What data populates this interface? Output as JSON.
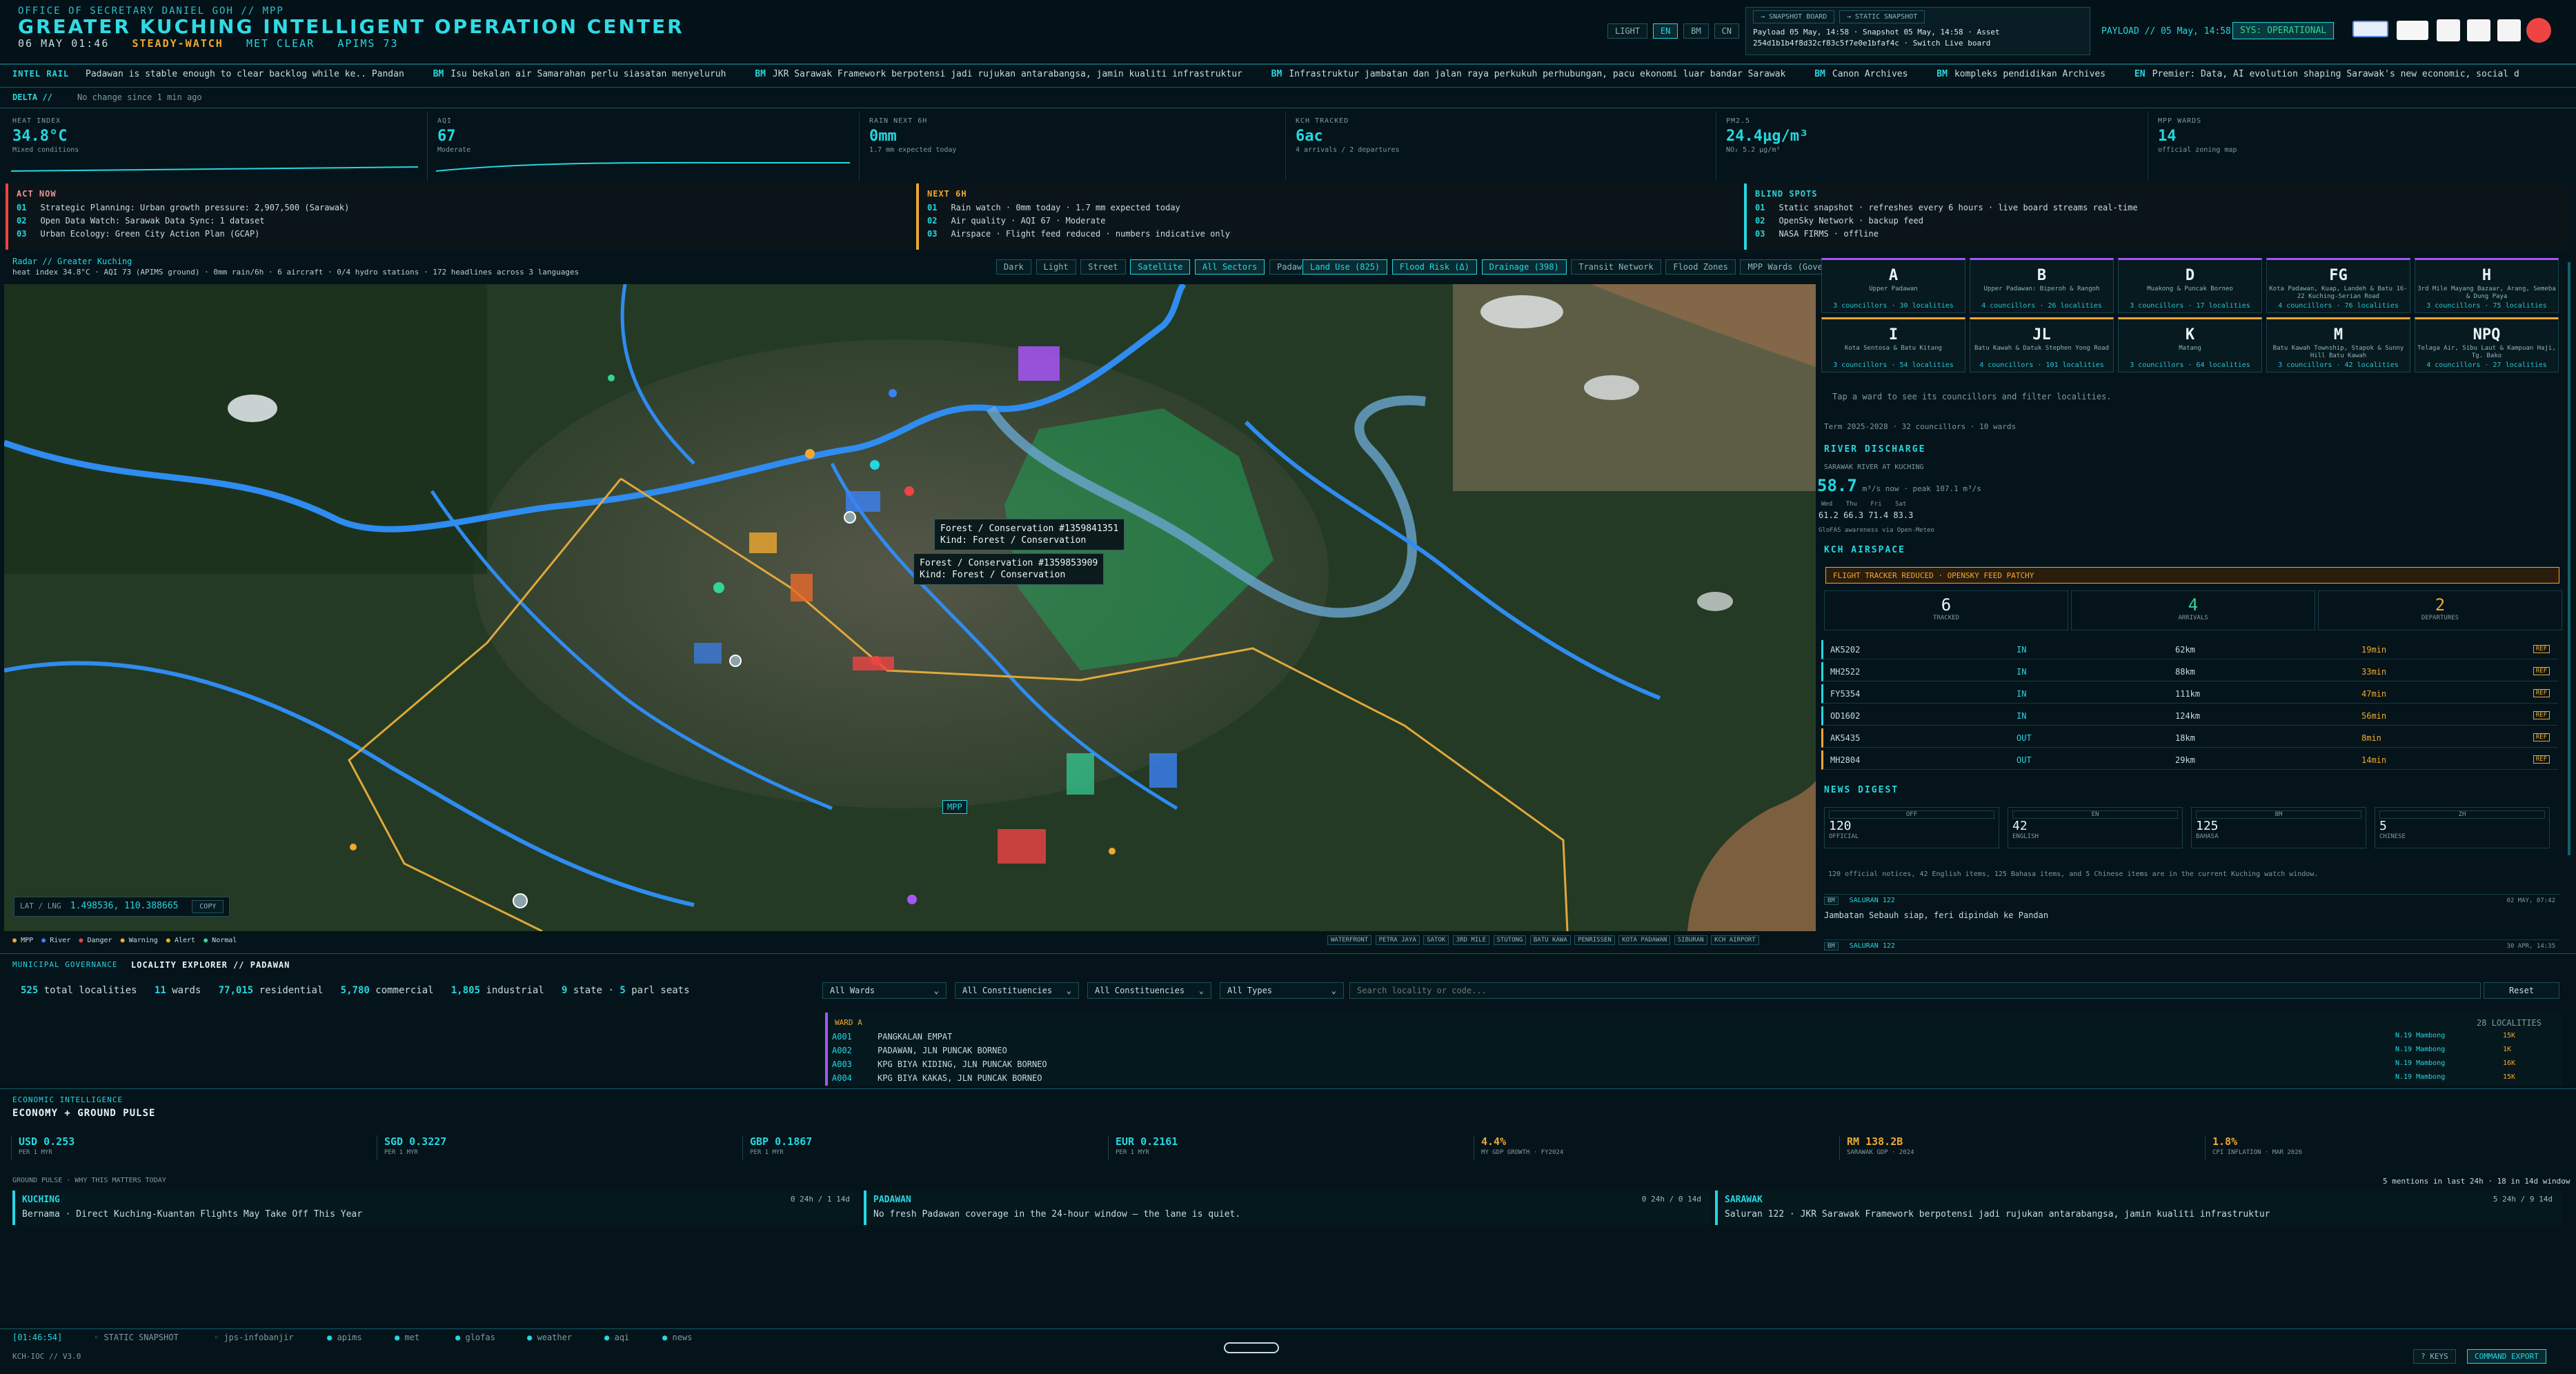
{
  "header": {
    "office": "OFFICE OF SECRETARY DANIEL GOH // MPP",
    "title": "GREATER KUCHING INTELLIGENT OPERATION CENTER",
    "date": "06 MAY 01:46",
    "mode": "STEADY-WATCH",
    "met": "MET CLEAR",
    "apims": "APIMS 73",
    "lang_buttons": [
      "LIGHT",
      "EN",
      "BM",
      "CN"
    ],
    "snapshot_buttons": [
      "→ SNAPSHOT BOARD",
      "→ STATIC SNAPSHOT"
    ],
    "payload_line": "Payload 05 May, 14:58 · Snapshot 05 May, 14:58 · Asset",
    "hash_line": "254d1b1b4f8d32cf83c5f7e0e1bfaf4c · Switch Live board",
    "payload_right": "PAYLOAD // 05 May, 14:58",
    "sys_status": "SYS: OPERATIONAL"
  },
  "rail": {
    "label": "INTEL RAIL",
    "items": [
      {
        "tag": "",
        "text": "Padawan is stable enough to clear backlog while ke.. Pandan"
      },
      {
        "tag": "BM",
        "text": "Isu bekalan air Samarahan perlu siasatan menyeluruh"
      },
      {
        "tag": "BM",
        "text": "JKR Sarawak Framework berpotensi jadi rujukan antarabangsa, jamin kualiti infrastruktur"
      },
      {
        "tag": "BM",
        "text": "Infrastruktur jambatan dan jalan raya perkukuh perhubungan, pacu ekonomi luar bandar Sarawak"
      },
      {
        "tag": "BM",
        "text": "Canon Archives"
      },
      {
        "tag": "BM",
        "text": "kompleks pendidikan Archives"
      },
      {
        "tag": "EN",
        "text": "Premier: Data, AI evolution shaping Sarawak's new economic, social d"
      }
    ],
    "delta_label": "DELTA //",
    "delta_text": "No change since 1 min ago"
  },
  "metrics": [
    {
      "label": "HEAT INDEX",
      "value": "34.8°C",
      "sub": "Mixed conditions"
    },
    {
      "label": "AQI",
      "value": "67",
      "sub": "Moderate"
    },
    {
      "label": "RAIN NEXT 6H",
      "value": "0mm",
      "sub": "1.7 mm expected today"
    },
    {
      "label": "KCH TRACKED",
      "value": "6ac",
      "sub": "4 arrivals / 2 departures"
    },
    {
      "label": "PM2.5",
      "value": "24.4µg/m³",
      "sub": "NO₂ 5.2 µg/m³"
    },
    {
      "label": "MPP WARDS",
      "value": "14",
      "sub": "official zoning map"
    }
  ],
  "act_now": {
    "title": "ACT NOW",
    "rows": [
      {
        "n": "01",
        "t": "Strategic Planning: Urban growth pressure: 2,907,500 (Sarawak)"
      },
      {
        "n": "02",
        "t": "Open Data Watch: Sarawak Data Sync: 1 dataset"
      },
      {
        "n": "03",
        "t": "Urban Ecology: Green City Action Plan (GCAP)"
      }
    ]
  },
  "next_6h": {
    "title": "NEXT 6H",
    "rows": [
      {
        "n": "01",
        "t": "Rain watch · 0mm today · 1.7 mm expected today"
      },
      {
        "n": "02",
        "t": "Air quality · AQI 67 · Moderate"
      },
      {
        "n": "03",
        "t": "Airspace · Flight feed reduced · numbers indicative only"
      }
    ]
  },
  "blind_spots": {
    "title": "BLIND SPOTS",
    "rows": [
      {
        "n": "01",
        "t": "Static snapshot · refreshes every 6 hours · live board streams real-time"
      },
      {
        "n": "02",
        "t": "OpenSky Network · backup feed"
      },
      {
        "n": "03",
        "t": "NASA FIRMS · offline"
      }
    ]
  },
  "radar": {
    "title": "Radar // Greater Kuching",
    "status": "heat index 34.8°C · AQI 73 (APIMS ground) · 0mm rain/6h · 6 aircraft · 0/4 hydro stations · 172 headlines across 3 languages",
    "base_buttons": [
      "Dark",
      "Light",
      "Street",
      "Satellite",
      "All Sectors",
      "Padawan"
    ],
    "layer_buttons": [
      "Land Use (825)",
      "Flood Risk (Δ)",
      "Drainage (398)",
      "Transit Network",
      "Flood Zones",
      "MPP Wards (Governance)"
    ],
    "popup1_title": "Forest / Conservation #1359841351",
    "popup1_kind": "Kind: Forest / Conservation",
    "popup2_title": "Forest / Conservation #1359853909",
    "popup2_kind": "Kind: Forest / Conservation",
    "mpp_label": "MPP",
    "coord_label": "LAT / LNG",
    "coord_value": "1.498536, 110.388665",
    "copy_label": "COPY",
    "legend": [
      {
        "label": "MPP",
        "color": "#f0a830"
      },
      {
        "label": "River",
        "color": "#3b82f6"
      },
      {
        "label": "Danger",
        "color": "#ef4444"
      },
      {
        "label": "Warning",
        "color": "#f0a830"
      },
      {
        "label": "Alert",
        "color": "#eab308"
      },
      {
        "label": "Normal",
        "color": "#34d399"
      }
    ],
    "places": [
      "WATERFRONT",
      "PETRA JAYA",
      "SATOK",
      "3RD MILE",
      "STUTONG",
      "BATU KAWA",
      "PENRISSEN",
      "KOTA PADAWAN",
      "SIBURAN",
      "KCH AIRPORT"
    ]
  },
  "wards": [
    {
      "code": "A",
      "desc": "Upper Padawan",
      "count": "3 councillors · 30 localities",
      "color": "#a855f7"
    },
    {
      "code": "B",
      "desc": "Upper Padawan: Biperoh & Rangoh",
      "count": "4 councillors · 26 localities",
      "color": "#a855f7"
    },
    {
      "code": "D",
      "desc": "Muakong & Puncak Borneo",
      "count": "3 councillors · 17 localities",
      "color": "#a855f7"
    },
    {
      "code": "FG",
      "desc": "Kota Padawan, Kuap, Landeh & Batu 16-22 Kuching-Serian Road",
      "count": "4 councillors · 76 localities",
      "color": "#a855f7"
    },
    {
      "code": "H",
      "desc": "3rd Mile Mayang Bazaar, Arang, Semeba & Dung Paya",
      "count": "3 councillors · 75 localities",
      "color": "#a855f7"
    },
    {
      "code": "I",
      "desc": "Kota Sentosa & Batu Kitang",
      "count": "3 councillors · 54 localities",
      "color": "#f0a830"
    },
    {
      "code": "JL",
      "desc": "Batu Kawah & Datuk Stephen Yong Road",
      "count": "4 councillors · 101 localities",
      "color": "#f0a830"
    },
    {
      "code": "K",
      "desc": "Matang",
      "count": "3 councillors · 64 localities",
      "color": "#f0a830"
    },
    {
      "code": "M",
      "desc": "Batu Kawah Township, Stapok & Sunny Hill Batu Kawah",
      "count": "3 councillors · 42 localities",
      "color": "#f0a830"
    },
    {
      "code": "NPQ",
      "desc": "Telaga Air, Sibu Laut & Kampuan Haji, Tg. Bako",
      "count": "4 councillors · 27 localities",
      "color": "#f0a830"
    }
  ],
  "ward_hint": "Tap a ward to see its councillors and filter localities.",
  "term": "Term 2025-2028 · 32 councillors · 10 wards",
  "river": {
    "title": "RIVER DISCHARGE",
    "station": "SARAWAK RIVER AT KUCHING",
    "value": "58.7",
    "unit": "m³/s now · peak 107.1 m³/s",
    "days": [
      "Wed",
      "Thu",
      "Fri",
      "Sat"
    ],
    "series": [
      "61.2",
      "66.3",
      "71.4",
      "83.3"
    ],
    "note": "GloFAS awareness via Open-Meteo"
  },
  "airspace": {
    "title": "KCH AIRSPACE",
    "banner": "FLIGHT TRACKER REDUCED · OPENSKY FEED PATCHY",
    "stats": [
      {
        "v": "6",
        "l": "TRACKED"
      },
      {
        "v": "4",
        "l": "ARRIVALS"
      },
      {
        "v": "2",
        "l": "DEPARTURES"
      }
    ],
    "flights": [
      {
        "id": "AK5202",
        "dir": "IN",
        "dist": "62km",
        "eta": "19min"
      },
      {
        "id": "MH2522",
        "dir": "IN",
        "dist": "88km",
        "eta": "33min"
      },
      {
        "id": "FY5354",
        "dir": "IN",
        "dist": "111km",
        "eta": "47min"
      },
      {
        "id": "OD1602",
        "dir": "IN",
        "dist": "124km",
        "eta": "56min"
      },
      {
        "id": "AK5435",
        "dir": "OUT",
        "dist": "18km",
        "eta": "8min"
      },
      {
        "id": "MH2804",
        "dir": "OUT",
        "dist": "29km",
        "eta": "14min"
      }
    ],
    "tag": "REF"
  },
  "news": {
    "title": "NEWS DIGEST",
    "boxes": [
      {
        "tag": "OFF",
        "v": "120",
        "l": "OFFICIAL"
      },
      {
        "tag": "EN",
        "v": "42",
        "l": "ENGLISH"
      },
      {
        "tag": "BM",
        "v": "125",
        "l": "BAHASA"
      },
      {
        "tag": "ZH",
        "v": "5",
        "l": "CHINESE"
      }
    ],
    "summary": "120 official notices, 42 English items, 125 Bahasa items, and 5 Chinese items are in the current Kuching watch window.",
    "items": [
      {
        "lang": "BM",
        "src": "SALURAN 122",
        "date": "02 MAY, 07:42",
        "title": "Jambatan Sebauh siap, feri dipindah ke Pandan"
      },
      {
        "lang": "BM",
        "src": "SALURAN 122",
        "date": "30 APR, 14:35",
        "title": ""
      }
    ]
  },
  "governance": {
    "label": "MUNICIPAL GOVERNANCE",
    "title": "LOCALITY EXPLORER // PADAWAN",
    "stats": [
      {
        "v": "525",
        "l": "total localities"
      },
      {
        "v": "11",
        "l": "wards"
      },
      {
        "v": "77,015",
        "l": "residential"
      },
      {
        "v": "5,780",
        "l": "commercial"
      },
      {
        "v": "1,805",
        "l": "industrial"
      },
      {
        "v": "9",
        "l": "state ·"
      },
      {
        "v": "5",
        "l": "parl seats"
      }
    ],
    "filters": [
      "All Wards",
      "All Constituencies",
      "All Constituencies",
      "All Types"
    ],
    "search_placeholder": "Search locality or code...",
    "reset": "Reset",
    "ward_header": "WARD A",
    "ward_count": "28 LOCALITIES",
    "rows": [
      {
        "code": "A001",
        "name": "PANGKALAN EMPAT",
        "seat": "N.19 Mambong",
        "val": "15K"
      },
      {
        "code": "A002",
        "name": "PADAWAN, JLN PUNCAK BORNEO",
        "seat": "N.19 Mambong",
        "val": "1K"
      },
      {
        "code": "A003",
        "name": "KPG BIYA KIDING, JLN PUNCAK BORNEO",
        "seat": "N.19 Mambong",
        "val": "16K"
      },
      {
        "code": "A004",
        "name": "KPG BIYA KAKAS, JLN PUNCAK BORNEO",
        "seat": "N.19 Mambong",
        "val": "15K"
      }
    ]
  },
  "economy": {
    "label": "ECONOMIC INTELLIGENCE",
    "title": "ECONOMY + GROUND PULSE",
    "tiles": [
      {
        "v": "USD 0.253",
        "l": "PER 1 MYR",
        "c": "#26d7e0"
      },
      {
        "v": "SGD 0.3227",
        "l": "PER 1 MYR",
        "c": "#26d7e0"
      },
      {
        "v": "GBP 0.1867",
        "l": "PER 1 MYR",
        "c": "#26d7e0"
      },
      {
        "v": "EUR 0.2161",
        "l": "PER 1 MYR",
        "c": "#26d7e0"
      },
      {
        "v": "4.4%",
        "l": "MY GDP GROWTH · FY2024",
        "c": "#f0a830"
      },
      {
        "v": "RM 138.2B",
        "l": "SARAWAK GDP · 2024",
        "c": "#f0a830"
      },
      {
        "v": "1.8%",
        "l": "CPI INFLATION · MAR 2026",
        "c": "#f0a830"
      }
    ],
    "pulse_label": "GROUND PULSE · WHY THIS MATTERS TODAY",
    "pulse_count": "5 mentions in last 24h · 18 in 14d window",
    "pulse": [
      {
        "t": "KUCHING",
        "c": "0 24h / 1 14d",
        "h": "Bernama · Direct Kuching-Kuantan Flights May Take Off This Year"
      },
      {
        "t": "PADAWAN",
        "c": "0 24h / 0 14d",
        "h": "No fresh Padawan coverage in the 24-hour window — the lane is quiet."
      },
      {
        "t": "SARAWAK",
        "c": "5 24h / 9 14d",
        "h": "Saluran 122 · JKR Sarawak Framework berpotensi jadi rujukan antarabangsa, jamin kualiti infrastruktur"
      }
    ]
  },
  "footer": {
    "time": "[01:46:54]",
    "items": [
      "STATIC SNAPSHOT",
      "jps-infobanjir",
      "apims",
      "met",
      "glofas",
      "weather",
      "aqi",
      "news"
    ],
    "version": "KCH-IOC // V3.0",
    "keys": "? KEYS",
    "cmd": "COMMAND EXPORT"
  }
}
